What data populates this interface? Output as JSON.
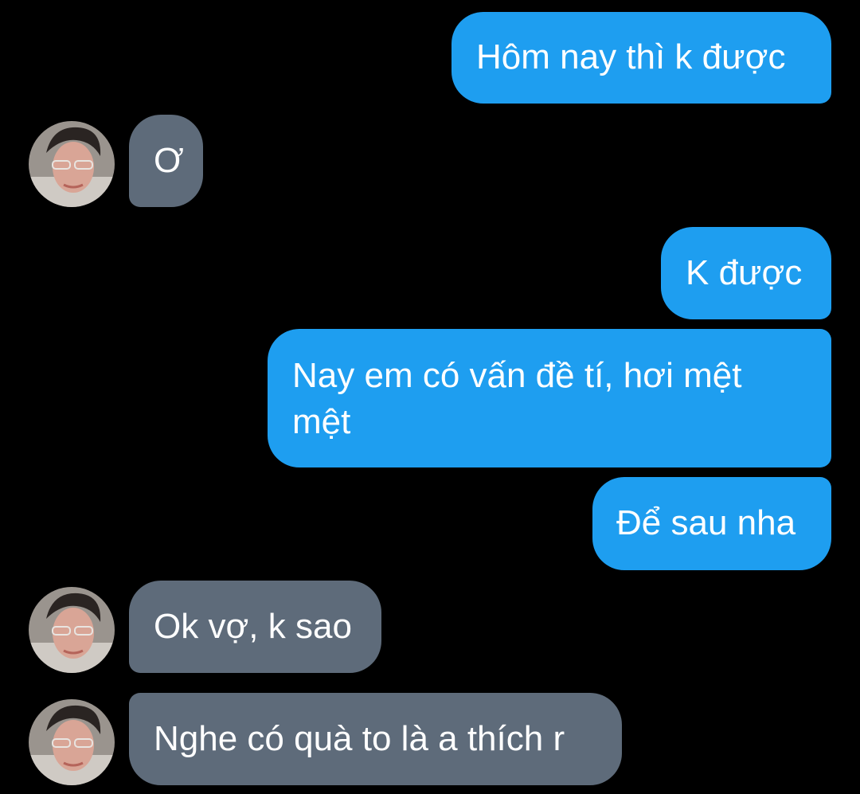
{
  "colors": {
    "background": "#000000",
    "outgoing_bubble": "#1e9ef0",
    "incoming_bubble": "#5e6b7a",
    "text": "#ffffff"
  },
  "messages": [
    {
      "direction": "outgoing",
      "text": "Hôm nay thì k được"
    },
    {
      "direction": "incoming",
      "text": "Ơ"
    },
    {
      "direction": "outgoing",
      "text": "K được"
    },
    {
      "direction": "outgoing",
      "text": "Nay em có vấn đề tí, hơi mệt mệt"
    },
    {
      "direction": "outgoing",
      "text": "Để sau nha"
    },
    {
      "direction": "incoming",
      "text": "Ok vợ, k sao"
    },
    {
      "direction": "incoming",
      "text": "Nghe có quà to là a thích r"
    }
  ],
  "icons": {
    "avatar": "contact-avatar-icon"
  }
}
